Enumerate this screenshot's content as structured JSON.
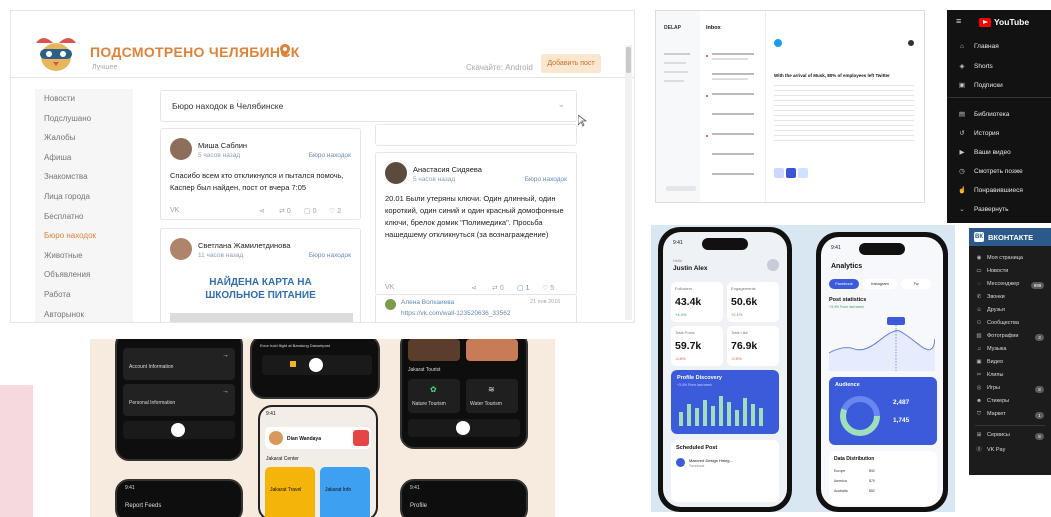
{
  "podsmotreno": {
    "title": "ПОДСМОТРЕНО ЧЕЛЯБИНСК",
    "subtitle": "Лучшее",
    "platform": "Скачайте: Android",
    "add_button": "Добавить пост",
    "sidebar": [
      "Новости",
      "Подслушано",
      "Жалобы",
      "Афиша",
      "Знакомства",
      "Лица города",
      "Бесплатно",
      "Бюро находок",
      "Животные",
      "Объявления",
      "Работа",
      "Авторынок"
    ],
    "feed_title": "Бюро находок в Челябинске",
    "posts": [
      {
        "author": "Миша Саблин",
        "time": "5 часов назад",
        "tag": "Бюро находок",
        "text": "Спасибо всем кто откликнулся и пытался помочь, Каспер был найден, пост от вчера 7:05",
        "reposts": "0",
        "comments": "0",
        "likes": "2"
      },
      {
        "author": "Анастасия Сидяева",
        "time": "5 часов назад",
        "tag": "Бюро находок",
        "text": "20.01 Были утеряны ключи. Один длинный, один короткий, один синий и один красный домофонные ключи, брелок домик \"Полимедика\". Просьба нашедшему откликнуться (за вознаграждение)",
        "reposts": "0",
        "comments": "1",
        "likes": "5"
      },
      {
        "author": "Светлана Жамилетдинова",
        "time": "11 часов назад",
        "tag": "Бюро находок",
        "banner": "НАЙДЕНА КАРТА НА ШКОЛЬНОЕ ПИТАНИЕ"
      }
    ],
    "comment": {
      "author": "Алена Волкаиева",
      "date": "21 янв 2016",
      "link": "https://vk.com/wall-123520636_33562"
    }
  },
  "youtube": {
    "brand": "YouTube",
    "items": [
      "Главная",
      "Shorts",
      "Подписки",
      "Библиотека",
      "История",
      "Ваши видео",
      "Смотреть позже",
      "Понравившиеся",
      "Развернуть"
    ]
  },
  "vk": {
    "brand": "ВКОНТАКТЕ",
    "items": [
      {
        "label": "Моя страница"
      },
      {
        "label": "Новости"
      },
      {
        "label": "Мессенджер",
        "count": "999"
      },
      {
        "label": "Звонки"
      },
      {
        "label": "Друзья"
      },
      {
        "label": "Сообщества"
      },
      {
        "label": "Фотографии",
        "count": "3"
      },
      {
        "label": "Музыка"
      },
      {
        "label": "Видео"
      },
      {
        "label": "Клипы"
      },
      {
        "label": "Игры",
        "count": "8"
      },
      {
        "label": "Стикеры"
      },
      {
        "label": "Маркет",
        "count": "1"
      },
      {
        "label": "Сервисы",
        "count": "8"
      },
      {
        "label": "VK Pay"
      }
    ]
  },
  "mail": {
    "brand": "DELAP",
    "inbox": "Inbox",
    "subject": "With the arrival of Musk, 80% of employees left Twitter"
  },
  "analytics": {
    "left": {
      "time": "9:41",
      "greeting": "Hello",
      "user": "Justin Alex",
      "stats": [
        {
          "label": "Followers",
          "value": "43.4k",
          "pct": "+4.5%"
        },
        {
          "label": "Engagements",
          "value": "50.6k",
          "pct": "+2.1%"
        },
        {
          "label": "Total Posts",
          "value": "59.7k",
          "pct": "-0.8%"
        },
        {
          "label": "Total Like",
          "value": "76.9k",
          "pct": "-0.5%"
        }
      ],
      "profile_title": "Profile Discovery",
      "profile_sub": "+3.4% From last week",
      "scheduled": "Scheduled Post",
      "scheduled_item": "Maxcred Design Hiring...",
      "scheduled_sub": "Facebook"
    },
    "right": {
      "time": "9:41",
      "title": "Analytics",
      "tabs": [
        "Facebook",
        "Instagram",
        "Tw"
      ],
      "post_stats": "Post statistics",
      "post_stats_sub": "+3.4% From last week",
      "audience": "Audience",
      "aud_vals": [
        "2,487",
        "1,745"
      ],
      "distribution": "Data Distribution",
      "rows": [
        {
          "name": "Europe",
          "v": "$92"
        },
        {
          "name": "America",
          "v": "$70"
        },
        {
          "name": "Australia",
          "v": "$52"
        }
      ]
    }
  },
  "dark": {
    "cards": [
      "Account Information",
      "Personal Information"
    ],
    "flight": "Error hold flight at Bandung Dansetpost",
    "user": "Dian Wandaya",
    "section": "Jakarat Center",
    "tiles": [
      "Jakarat Travel",
      "Jakarat Info"
    ],
    "tourist": "Jakarat Tourist",
    "tourist_tiles": [
      "Nature Tourism",
      "Water Tourism"
    ],
    "report": "Report Feeds",
    "profile": "Profile",
    "time": "9:41"
  }
}
